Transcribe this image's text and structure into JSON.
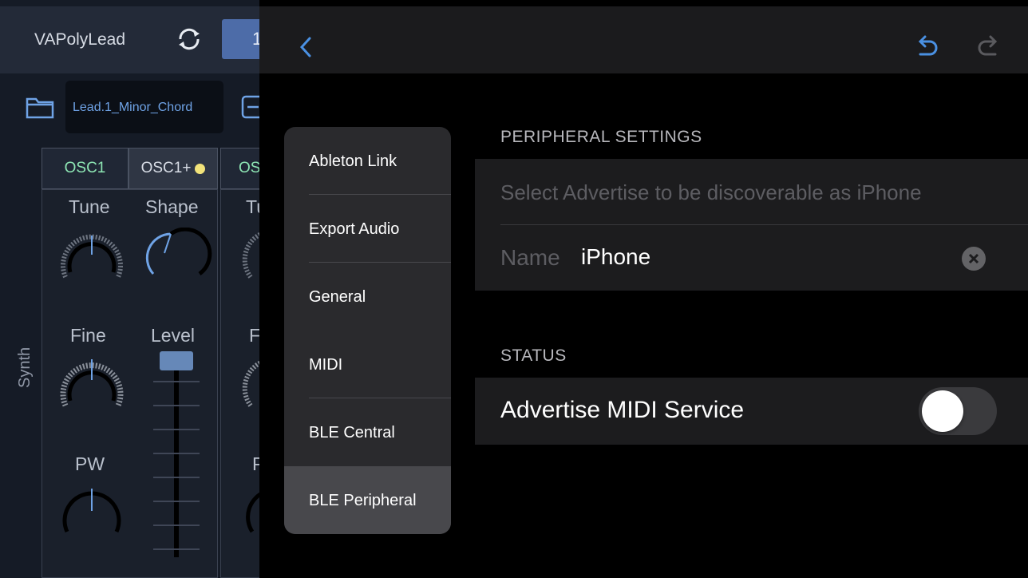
{
  "synth": {
    "preset_name": "VAPolyLead",
    "bank_number": "1",
    "patch_name": "Lead.1_Minor_Chord",
    "section_label": "Synth",
    "tabs": [
      "OSC1",
      "OSC1+",
      "OS"
    ],
    "knobs": {
      "tune": "Tune",
      "shape": "Shape",
      "fine": "Fine",
      "level": "Level",
      "pw": "PW",
      "tune_partial": "Tu",
      "fine_partial": "F",
      "pw_partial": "P"
    }
  },
  "settings": {
    "nav": {
      "back_icon": "chevron-left-icon",
      "undo_icon": "undo-icon",
      "redo_icon": "redo-icon"
    },
    "menu": [
      {
        "label": "Ableton Link",
        "selected": false
      },
      {
        "label": "Export Audio",
        "selected": false
      },
      {
        "label": "General",
        "selected": false
      },
      {
        "label": "MIDI",
        "selected": false
      },
      {
        "label": "BLE Central",
        "selected": false
      },
      {
        "label": "BLE Peripheral",
        "selected": true
      }
    ],
    "peripheral": {
      "header": "PERIPHERAL SETTINGS",
      "hint": "Select Advertise to be discoverable as iPhone",
      "name_label": "Name",
      "name_value": "iPhone"
    },
    "status": {
      "header": "STATUS",
      "advertise_label": "Advertise MIDI Service",
      "advertise_on": false
    },
    "colors": {
      "accent": "#4a90e2",
      "menu_selected": "#48484c",
      "osc_tab_text": "#8ee6b4"
    }
  }
}
